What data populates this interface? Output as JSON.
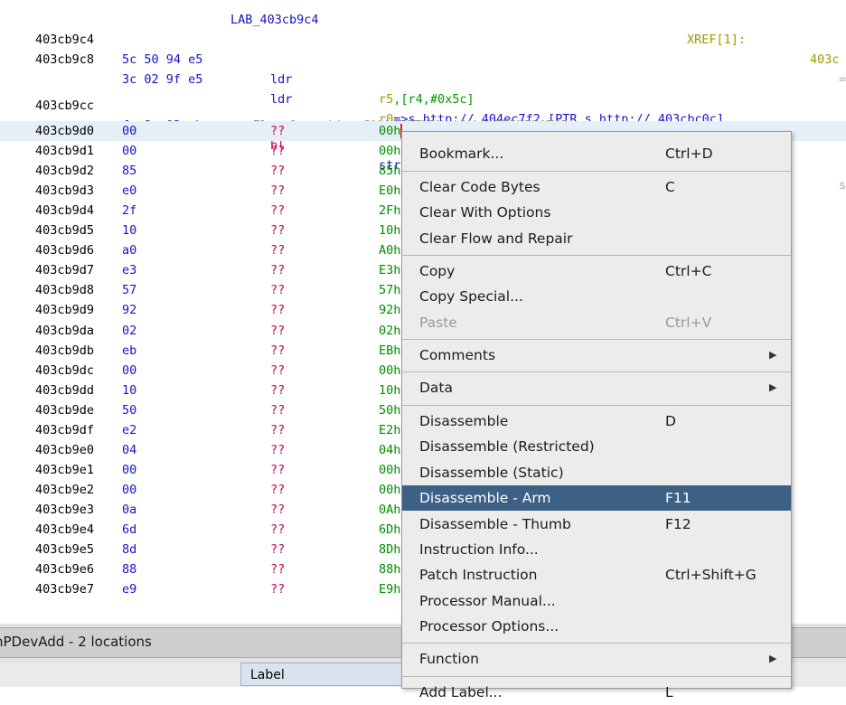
{
  "listing": {
    "top_partial": {
      "label": "LAB_403cb9c4",
      "xref": "XREF[1]:",
      "xref_addr": "403c"
    },
    "lines": [
      {
        "addr": "403cb9c4",
        "bytes": "5c 50 94 e5",
        "mnem": "ldr",
        "op_reg": "r5",
        "op_rest": ",[r4,#0x5c]"
      },
      {
        "addr": "403cb9c8",
        "bytes": "3c 02 9f e5",
        "mnem": "ldr",
        "op_reg": "r0",
        "op_rest": "=>s_http://_404ec7f2,[PTR_s_http://_403cbc0c]"
      },
      {
        "addr": "403cb9cc",
        "bytes": "fa 8e 02 eb",
        "mnem": "bl",
        "op_reg": "",
        "op_rest": "strlen"
      }
    ],
    "right_marks": [
      "=",
      "=",
      "s"
    ],
    "override": "-- Flow Override: CALL_RETURN (CALL_TERMINATOR)",
    "undefined_rows": [
      {
        "addr": "403cb9d0",
        "byte": "00",
        "mnem": "??",
        "op": "00h"
      },
      {
        "addr": "403cb9d1",
        "byte": "00",
        "mnem": "??",
        "op": "00h"
      },
      {
        "addr": "403cb9d2",
        "byte": "85",
        "mnem": "??",
        "op": "85h"
      },
      {
        "addr": "403cb9d3",
        "byte": "e0",
        "mnem": "??",
        "op": "E0h"
      },
      {
        "addr": "403cb9d4",
        "byte": "2f",
        "mnem": "??",
        "op": "2Fh"
      },
      {
        "addr": "403cb9d5",
        "byte": "10",
        "mnem": "??",
        "op": "10h"
      },
      {
        "addr": "403cb9d6",
        "byte": "a0",
        "mnem": "??",
        "op": "A0h"
      },
      {
        "addr": "403cb9d7",
        "byte": "e3",
        "mnem": "??",
        "op": "E3h"
      },
      {
        "addr": "403cb9d8",
        "byte": "57",
        "mnem": "??",
        "op": "57h"
      },
      {
        "addr": "403cb9d9",
        "byte": "92",
        "mnem": "??",
        "op": "92h"
      },
      {
        "addr": "403cb9da",
        "byte": "02",
        "mnem": "??",
        "op": "02h"
      },
      {
        "addr": "403cb9db",
        "byte": "eb",
        "mnem": "??",
        "op": "EBh"
      },
      {
        "addr": "403cb9dc",
        "byte": "00",
        "mnem": "??",
        "op": "00h"
      },
      {
        "addr": "403cb9dd",
        "byte": "10",
        "mnem": "??",
        "op": "10h"
      },
      {
        "addr": "403cb9de",
        "byte": "50",
        "mnem": "??",
        "op": "50h"
      },
      {
        "addr": "403cb9df",
        "byte": "e2",
        "mnem": "??",
        "op": "E2h"
      },
      {
        "addr": "403cb9e0",
        "byte": "04",
        "mnem": "??",
        "op": "04h"
      },
      {
        "addr": "403cb9e1",
        "byte": "00",
        "mnem": "??",
        "op": "00h"
      },
      {
        "addr": "403cb9e2",
        "byte": "00",
        "mnem": "??",
        "op": "00h"
      },
      {
        "addr": "403cb9e3",
        "byte": "0a",
        "mnem": "??",
        "op": "0Ah"
      },
      {
        "addr": "403cb9e4",
        "byte": "6d",
        "mnem": "??",
        "op": "6Dh"
      },
      {
        "addr": "403cb9e5",
        "byte": "8d",
        "mnem": "??",
        "op": "8Dh"
      },
      {
        "addr": "403cb9e6",
        "byte": "88",
        "mnem": "??",
        "op": "88h"
      },
      {
        "addr": "403cb9e7",
        "byte": "e9",
        "mnem": "??",
        "op": "E9h"
      }
    ]
  },
  "bottom_panel": {
    "title": "nPDevAdd - 2 locations",
    "column_label": "Label"
  },
  "context_menu": {
    "items": [
      {
        "label": "Bookmark...",
        "shortcut": "Ctrl+D"
      },
      {
        "label": "Clear Code Bytes",
        "shortcut": "C"
      },
      {
        "label": "Clear With Options",
        "shortcut": ""
      },
      {
        "label": "Clear Flow and Repair",
        "shortcut": ""
      },
      {
        "label": "Copy",
        "shortcut": "Ctrl+C"
      },
      {
        "label": "Copy Special...",
        "shortcut": ""
      },
      {
        "label": "Paste",
        "shortcut": "Ctrl+V"
      },
      {
        "label": "Comments",
        "shortcut": ""
      },
      {
        "label": "Data",
        "shortcut": ""
      },
      {
        "label": "Disassemble",
        "shortcut": "D"
      },
      {
        "label": "Disassemble (Restricted)",
        "shortcut": ""
      },
      {
        "label": "Disassemble (Static)",
        "shortcut": ""
      },
      {
        "label": "Disassemble - Arm",
        "shortcut": "F11"
      },
      {
        "label": "Disassemble - Thumb",
        "shortcut": "F12"
      },
      {
        "label": "Instruction Info...",
        "shortcut": ""
      },
      {
        "label": "Patch Instruction",
        "shortcut": "Ctrl+Shift+G"
      },
      {
        "label": "Processor Manual...",
        "shortcut": ""
      },
      {
        "label": "Processor Options...",
        "shortcut": ""
      },
      {
        "label": "Function",
        "shortcut": ""
      },
      {
        "label": "Add Label...",
        "shortcut": "L"
      }
    ],
    "submenu_arrow": "▶",
    "highlight_color": "#3d6185"
  }
}
